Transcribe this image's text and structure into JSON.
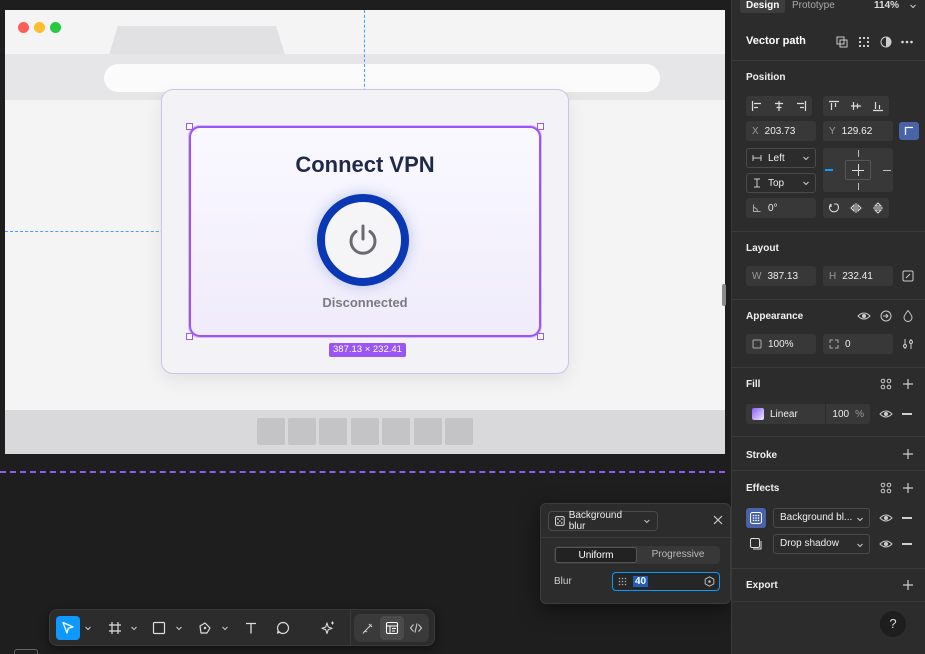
{
  "canvas": {
    "card_title": "Connect VPN",
    "status": "Disconnected",
    "selection_size": "387.13 × 232.41",
    "footer_button_count": 7
  },
  "popup": {
    "effect_type": "Background blur",
    "tabs": {
      "uniform": "Uniform",
      "progressive": "Progressive"
    },
    "blur_label": "Blur",
    "blur_value": "40"
  },
  "panel": {
    "tabs": {
      "design": "Design",
      "prototype": "Prototype"
    },
    "zoom": "114%",
    "layer_title": "Vector path",
    "position": {
      "title": "Position",
      "x_label": "X",
      "x": "203.73",
      "y_label": "Y",
      "y": "129.62",
      "h_constraint": "Left",
      "v_constraint": "Top",
      "rotation": "0°"
    },
    "layout": {
      "title": "Layout",
      "w_label": "W",
      "w": "387.13",
      "h_label": "H",
      "h": "232.41"
    },
    "appearance": {
      "title": "Appearance",
      "opacity": "100%",
      "radius": "0"
    },
    "fill": {
      "title": "Fill",
      "type": "Linear",
      "opacity": "100",
      "percent": "%"
    },
    "stroke": {
      "title": "Stroke"
    },
    "effects": {
      "title": "Effects",
      "items": [
        "Background bl...",
        "Drop shadow"
      ]
    },
    "export": {
      "title": "Export"
    },
    "help": "?"
  },
  "colors": {
    "accent": "#0d99ff",
    "selection": "#9b55f5",
    "power_ring": "#0a37b3"
  }
}
